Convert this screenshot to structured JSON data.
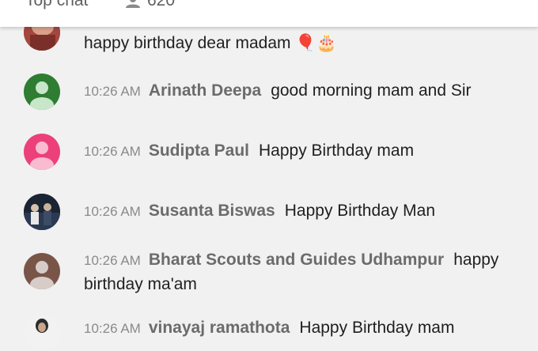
{
  "header": {
    "title": "Top chat",
    "viewer_count": "620"
  },
  "messages": [
    {
      "time": "",
      "author": "",
      "text": "happy birthday dear madam",
      "emoji": "🎈🎂"
    },
    {
      "time": "10:26 AM",
      "author": "Arinath Deepa",
      "text": "good morning mam and Sir"
    },
    {
      "time": "10:26 AM",
      "author": "Sudipta Paul",
      "text": "Happy Birthday mam"
    },
    {
      "time": "10:26 AM",
      "author": "Susanta Biswas",
      "text": "Happy Birthday Man"
    },
    {
      "time": "10:26 AM",
      "author": "Bharat Scouts and Guides Udhampur",
      "text": "happy birthday ma'am"
    },
    {
      "time": "10:26 AM",
      "author": "vinayaj ramathota",
      "text": "Happy Birthday mam"
    }
  ],
  "colors": {
    "background": "#f1f1f1",
    "avatar_green": "#2e7d32",
    "avatar_pink": "#ec407a",
    "avatar_brown": "#795548"
  }
}
